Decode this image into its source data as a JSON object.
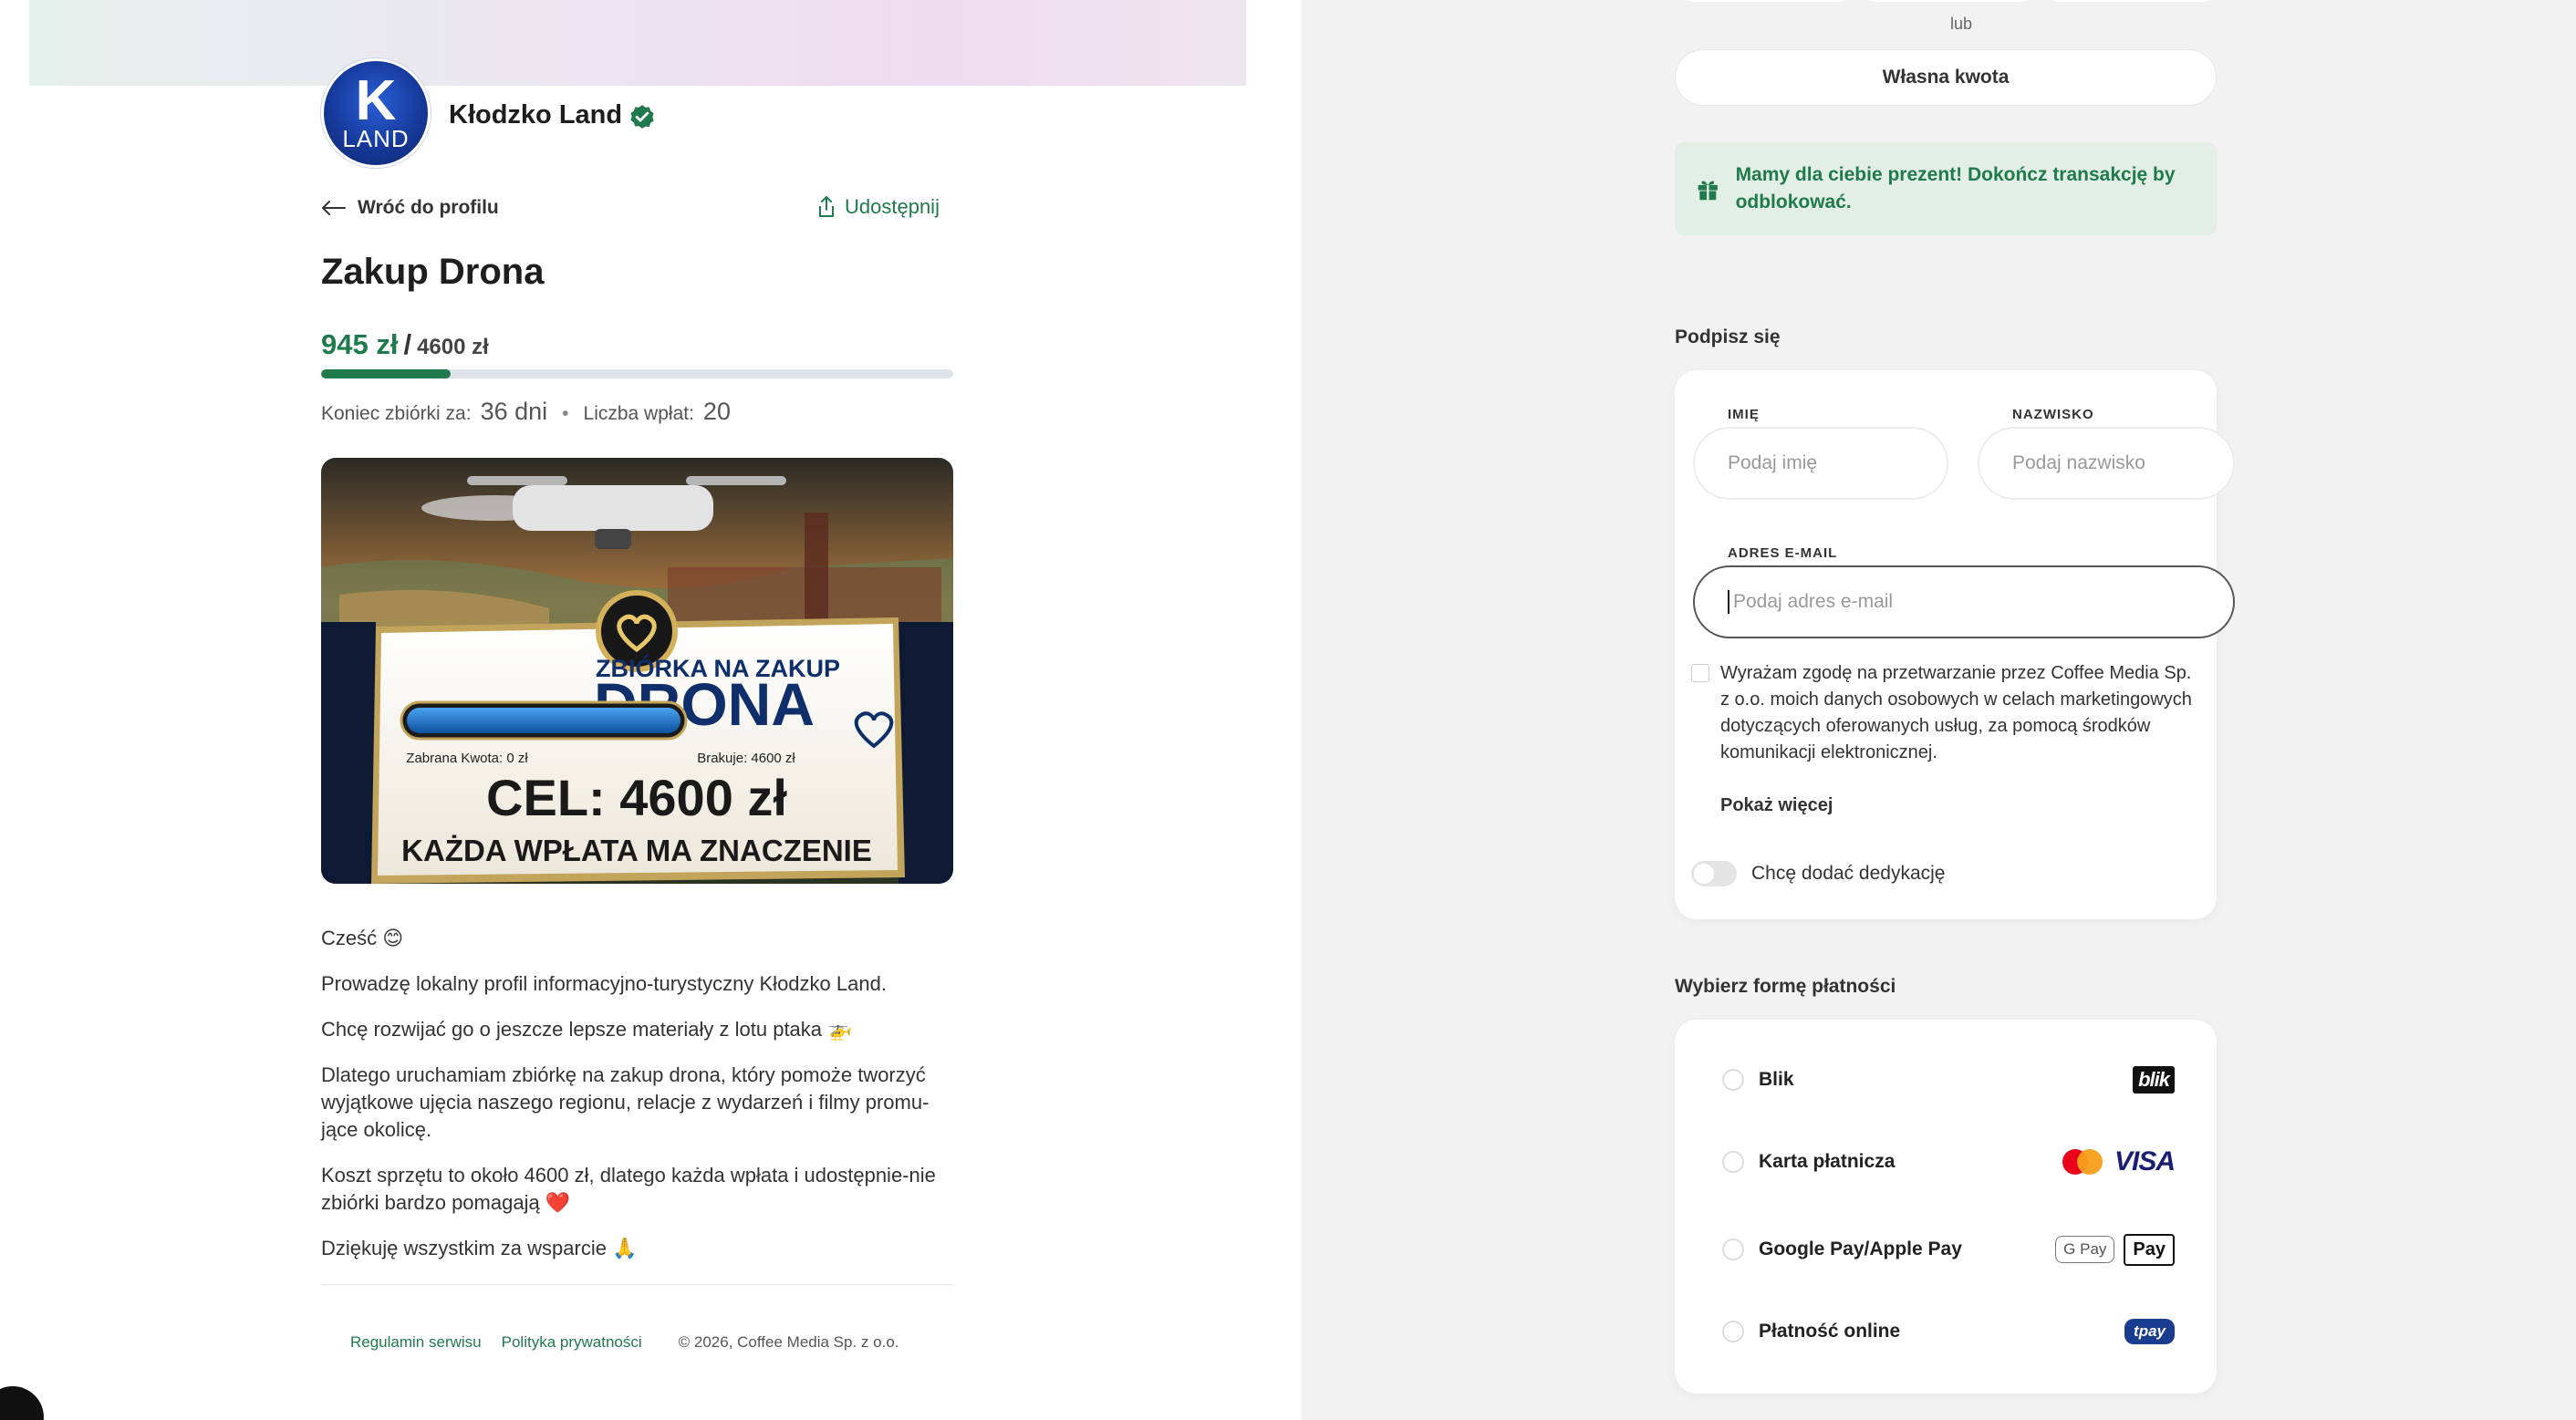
{
  "profile": {
    "name": "Kłodzko Land",
    "avatar_letter": "K",
    "avatar_text": "LAND",
    "back_label": "Wróć do profilu",
    "share_label": "Udostępnij"
  },
  "campaign": {
    "title": "Zakup Drona",
    "raised": "945 zł",
    "separator": "/",
    "goal": "4600 zł",
    "progress_fraction": 0.205,
    "end_label": "Koniec zbiórki za:",
    "end_value": "36 dni",
    "count_label": "Liczba wpłat:",
    "count_value": "20",
    "image": {
      "headline_small": "ZBIÓRKA NA ZAKUP",
      "headline_big": "DRONA",
      "collected_label": "Zabrana Kwota: 0 zł",
      "missing_label": "Brakuje: 4600 zł",
      "target": "CEL: 4600 zł",
      "tagline": "KAŻDA WPŁATA MA ZNACZENIE"
    },
    "description": [
      "Cześć 😊",
      "Prowadzę lokalny profil informacyjno-turystyczny Kłodzko Land.",
      "Chcę rozwijać go o jeszcze lepsze materiały z lotu ptaka 🚁",
      "Dlatego uruchamiam zbiórkę na zakup drona, który pomoże tworzyć wyjątkowe ujęcia naszego regionu, relacje z wydarzeń i filmy promu-jące okolicę.",
      "Koszt sprzętu to około 4600 zł, dlatego każda wpłata i udostępnie-nie zbiórki bardzo pomagają ❤️",
      "Dziękuję wszystkim za wsparcie 🙏"
    ]
  },
  "footer": {
    "terms": "Regulamin serwisu",
    "privacy": "Polityka prywatności",
    "copyright": "© 2026, Coffee Media Sp. z o.o."
  },
  "donation": {
    "or_label": "lub",
    "custom_amount": "Własna kwota",
    "gift_message": "Mamy dla ciebie prezent! Dokończ transakcję by odblokować."
  },
  "sign": {
    "section_title": "Podpisz się",
    "first_name_label": "IMIĘ",
    "first_name_placeholder": "Podaj imię",
    "last_name_label": "NAZWISKO",
    "last_name_placeholder": "Podaj nazwisko",
    "email_label": "ADRES E-MAIL",
    "email_placeholder": "Podaj adres e-mail",
    "consent_text": "Wyrażam zgodę na przetwarzanie przez Coffee Media Sp. z o.o. moich danych osobowych w celach marketingowych dotyczących oferowanych usług, za pomocą środków komunikacji elektronicznej.",
    "show_more": "Pokaż więcej",
    "dedication_label": "Chcę dodać dedykację"
  },
  "payment": {
    "section_title": "Wybierz formę płatności",
    "methods": [
      {
        "label": "Blik",
        "logo": "blik"
      },
      {
        "label": "Karta płatnicza",
        "logo": "VISA"
      },
      {
        "label": "Google Pay/Apple Pay",
        "logo_g": "G Pay",
        "logo_a": "Pay"
      },
      {
        "label": "Płatność online",
        "logo": "tpay"
      }
    ]
  },
  "colors": {
    "accent": "#1f7a4d",
    "gift_bg": "#e3efe6",
    "right_bg": "#f2f2f2"
  }
}
